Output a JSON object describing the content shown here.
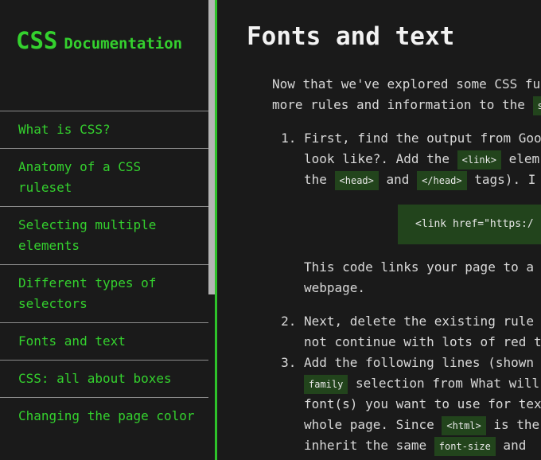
{
  "sidebar": {
    "title_big": "CSS",
    "title_small": "Documentation",
    "items": [
      {
        "label": "What is CSS?"
      },
      {
        "label": "Anatomy of a CSS ruleset"
      },
      {
        "label": "Selecting multiple elements"
      },
      {
        "label": "Different types of selectors"
      },
      {
        "label": "Fonts and text"
      },
      {
        "label": "CSS: all about boxes"
      },
      {
        "label": "Changing the page color"
      }
    ]
  },
  "main": {
    "heading": "Fonts and text",
    "intro": {
      "line1": "Now that we've explored some CSS fur",
      "line2_text": "more rules and information to the ",
      "line2_code": "s"
    },
    "step1": {
      "line1": "First, find the output from Goo",
      "line2_a": "look like?. Add the ",
      "line2_code": "<link>",
      "line2_b": " elem",
      "line3_a": "the ",
      "line3_code1": "<head>",
      "line3_b": " and ",
      "line3_code2": "</head>",
      "line3_c": " tags). I",
      "codeblock": "<link href=\"https:/",
      "after1": "This code links your page to a",
      "after2": "webpage."
    },
    "step2": {
      "line1": "Next, delete the existing rule",
      "line2": "not continue with lots of red t"
    },
    "step3": {
      "line1": "Add the following lines (shown",
      "line2_code": "family",
      "line2_b": " selection from What will",
      "line3": "font(s) you want to use for tex",
      "line4_a": "whole page. Since ",
      "line4_code": "<html>",
      "line4_b": " is the",
      "line5_a": "inherit the same ",
      "line5_code": "font-size",
      "line5_b": " and"
    }
  },
  "colors": {
    "accent": "#34d12e",
    "background": "#1a1a1a",
    "code_background": "#22441c"
  }
}
